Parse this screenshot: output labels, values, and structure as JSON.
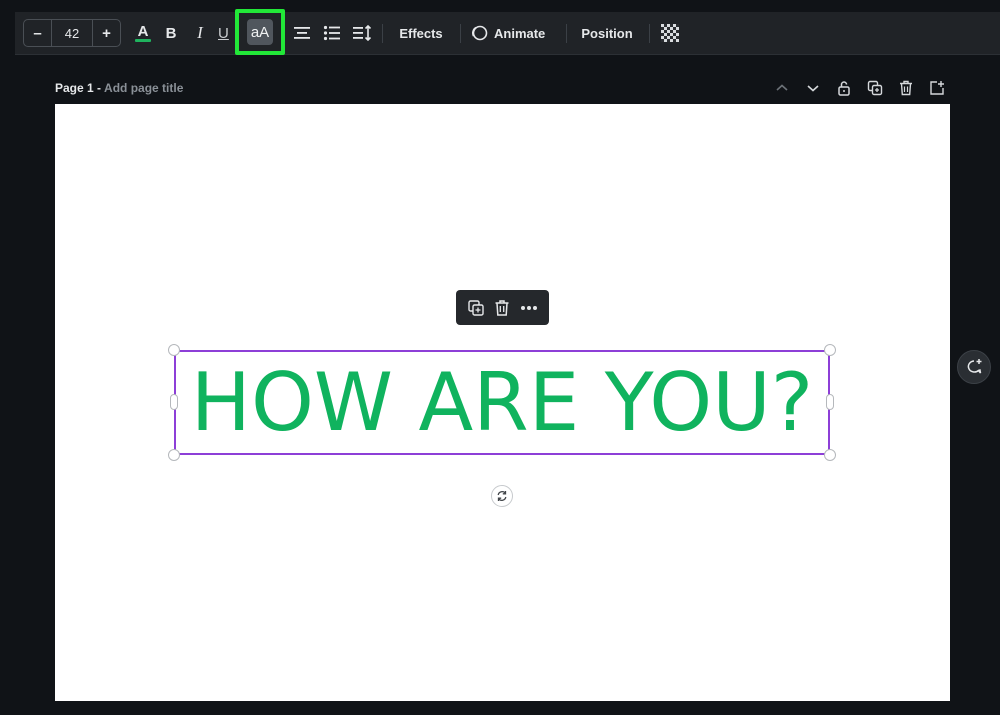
{
  "toolbar": {
    "font_size": {
      "decrease_label": "–",
      "value": "42",
      "increase_label": "+"
    },
    "text_color": "#1fb35e",
    "bold_label": "B",
    "italic_label": "I",
    "underline_label": "U",
    "letter_case_label": "aA",
    "letter_case_highlight": "#22e838",
    "effects_label": "Effects",
    "animate_label": "Animate",
    "position_label": "Position",
    "icons": [
      "text-color-icon",
      "bold-icon",
      "italic-icon",
      "underline-icon",
      "letter-case-icon",
      "align-center-icon",
      "list-icon",
      "spacing-icon",
      "animate-icon",
      "transparency-icon"
    ]
  },
  "page": {
    "label": "Page 1 -",
    "title_placeholder": "Add page title",
    "controls": [
      "chevron-up-icon",
      "chevron-down-icon",
      "lock-icon",
      "duplicate-page-icon",
      "delete-page-icon",
      "add-page-icon"
    ]
  },
  "canvas": {
    "background": "#ffffff",
    "text": "HOW ARE YOU?",
    "text_color": "#10b35e",
    "selection_color": "#8d3fd7",
    "element_toolbar": [
      "copy-icon",
      "trash-icon",
      "more-icon"
    ]
  }
}
